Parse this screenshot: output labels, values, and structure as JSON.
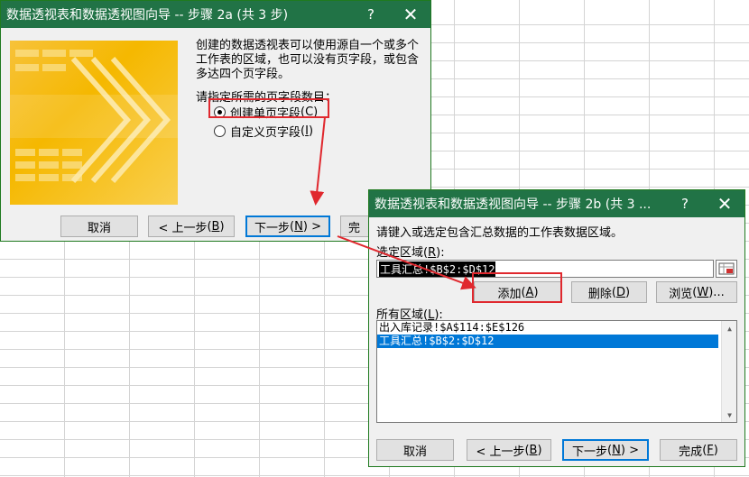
{
  "sheet": {
    "cell_peek": "10"
  },
  "dialog1": {
    "title": "数据透视表和数据透视图向导 -- 步骤 2a (共 3 步)",
    "help": "?",
    "close": "✕",
    "description": "创建的数据透视表可以使用源自一个或多个工作表的区域，也可以没有页字段，或包含多达四个页字段。",
    "prompt": "请指定所需的页字段数目：",
    "radio_single": {
      "label": "创建单页字段",
      "mnemonic": "C",
      "selected": true
    },
    "radio_custom": {
      "label": "自定义页字段",
      "mnemonic": "I",
      "selected": false
    },
    "buttons": {
      "cancel": "取消",
      "back": "< 上一步",
      "back_mn": "B",
      "next": "下一步",
      "next_mn": "N",
      "next_suffix": " >",
      "finish": "完"
    }
  },
  "dialog2": {
    "title": "数据透视表和数据透视图向导 -- 步骤 2b (共 3 ...",
    "help": "?",
    "close": "✕",
    "instruction": "请键入或选定包含汇总数据的工作表数据区域。",
    "range_label": "选定区域",
    "range_mn": "R",
    "range_value": "工具汇总!$B$2:$D$12",
    "add_label": "添加",
    "add_mn": "A",
    "delete_label": "删除",
    "delete_mn": "D",
    "browse_label": "浏览",
    "browse_mn": "W",
    "all_label": "所有区域",
    "all_mn": "L",
    "ranges": [
      {
        "text": "出入库记录!$A$114:$E$126",
        "selected": false
      },
      {
        "text": "工具汇总!$B$2:$D$12",
        "selected": true
      }
    ],
    "buttons": {
      "cancel": "取消",
      "back": "< 上一步",
      "back_mn": "B",
      "next": "下一步",
      "next_mn": "N",
      "next_suffix": " >",
      "finish": "完成",
      "finish_mn": "F"
    }
  },
  "colors": {
    "titlebar": "#217346",
    "highlight": "#e0282e",
    "selection": "#0078d7",
    "art": "#f5b800"
  }
}
